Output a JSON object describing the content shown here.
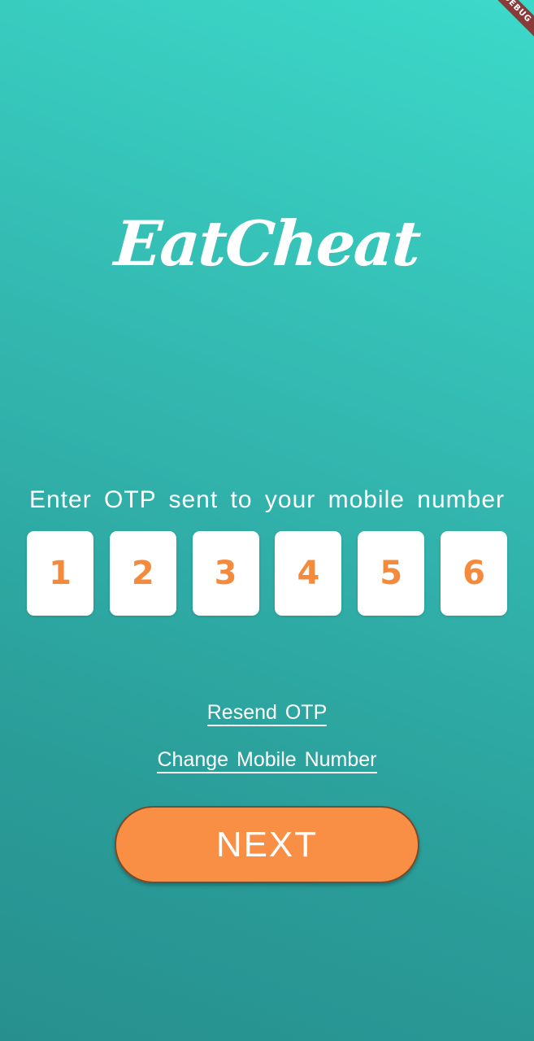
{
  "debug_banner": "DEBUG",
  "app": {
    "logo_text": "EatCheat"
  },
  "otp": {
    "prompt": "Enter OTP sent to your mobile number",
    "digits": [
      "1",
      "2",
      "3",
      "4",
      "5",
      "6"
    ]
  },
  "links": {
    "resend": "Resend OTP",
    "change_number": "Change Mobile Number"
  },
  "actions": {
    "next_label": "NEXT"
  },
  "colors": {
    "background_top": "#3cd9c9",
    "background_bottom": "#27908f",
    "digit_color": "#f48a3c",
    "button_color": "#f98f45"
  }
}
